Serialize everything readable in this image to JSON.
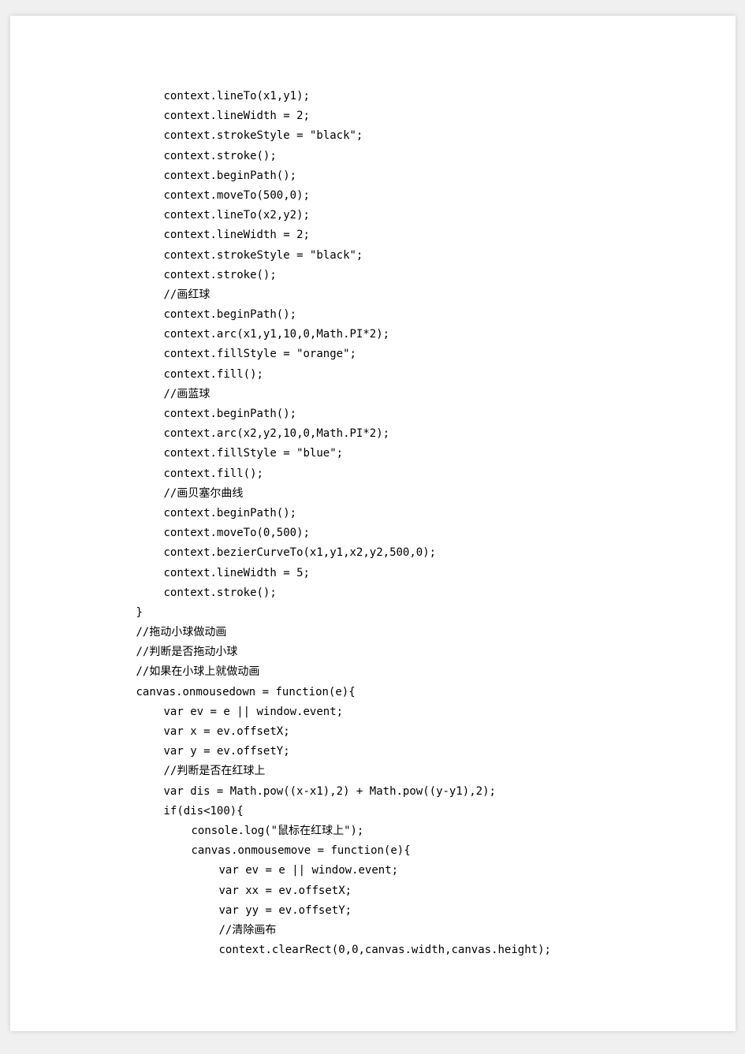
{
  "code": {
    "lines": [
      {
        "indent": 2,
        "text": "context.lineTo(x1,y1);"
      },
      {
        "indent": 2,
        "text": "context.lineWidth = 2;"
      },
      {
        "indent": 2,
        "text": "context.strokeStyle = \"black\";"
      },
      {
        "indent": 2,
        "text": "context.stroke();"
      },
      {
        "indent": 2,
        "text": "context.beginPath();"
      },
      {
        "indent": 2,
        "text": "context.moveTo(500,0);"
      },
      {
        "indent": 2,
        "text": "context.lineTo(x2,y2);"
      },
      {
        "indent": 2,
        "text": "context.lineWidth = 2;"
      },
      {
        "indent": 2,
        "text": "context.strokeStyle = \"black\";"
      },
      {
        "indent": 2,
        "text": "context.stroke();"
      },
      {
        "indent": 2,
        "text": "//画红球"
      },
      {
        "indent": 2,
        "text": "context.beginPath();"
      },
      {
        "indent": 2,
        "text": "context.arc(x1,y1,10,0,Math.PI*2);"
      },
      {
        "indent": 2,
        "text": "context.fillStyle = \"orange\";"
      },
      {
        "indent": 2,
        "text": "context.fill();"
      },
      {
        "indent": 2,
        "text": "//画蓝球"
      },
      {
        "indent": 2,
        "text": "context.beginPath();"
      },
      {
        "indent": 2,
        "text": "context.arc(x2,y2,10,0,Math.PI*2);"
      },
      {
        "indent": 2,
        "text": "context.fillStyle = \"blue\";"
      },
      {
        "indent": 2,
        "text": "context.fill();"
      },
      {
        "indent": 2,
        "text": "//画贝塞尔曲线"
      },
      {
        "indent": 2,
        "text": "context.beginPath();"
      },
      {
        "indent": 2,
        "text": "context.moveTo(0,500);"
      },
      {
        "indent": 2,
        "text": "context.bezierCurveTo(x1,y1,x2,y2,500,0);"
      },
      {
        "indent": 2,
        "text": "context.lineWidth = 5;"
      },
      {
        "indent": 2,
        "text": "context.stroke();"
      },
      {
        "indent": 1,
        "text": "}"
      },
      {
        "indent": 1,
        "text": "//拖动小球做动画"
      },
      {
        "indent": 1,
        "text": "//判断是否拖动小球"
      },
      {
        "indent": 1,
        "text": "//如果在小球上就做动画"
      },
      {
        "indent": 1,
        "text": "canvas.onmousedown = function(e){"
      },
      {
        "indent": 2,
        "text": "var ev = e || window.event;"
      },
      {
        "indent": 2,
        "text": "var x = ev.offsetX;"
      },
      {
        "indent": 2,
        "text": "var y = ev.offsetY;"
      },
      {
        "indent": 2,
        "text": "//判断是否在红球上"
      },
      {
        "indent": 2,
        "text": "var dis = Math.pow((x-x1),2) + Math.pow((y-y1),2);"
      },
      {
        "indent": 2,
        "text": "if(dis<100){"
      },
      {
        "indent": 3,
        "text": "console.log(\"鼠标在红球上\");"
      },
      {
        "indent": 3,
        "text": "canvas.onmousemove = function(e){"
      },
      {
        "indent": 4,
        "text": "var ev = e || window.event;"
      },
      {
        "indent": 4,
        "text": "var xx = ev.offsetX;"
      },
      {
        "indent": 4,
        "text": "var yy = ev.offsetY;"
      },
      {
        "indent": 4,
        "text": "//清除画布"
      },
      {
        "indent": 4,
        "text": "context.clearRect(0,0,canvas.width,canvas.height);"
      }
    ]
  }
}
